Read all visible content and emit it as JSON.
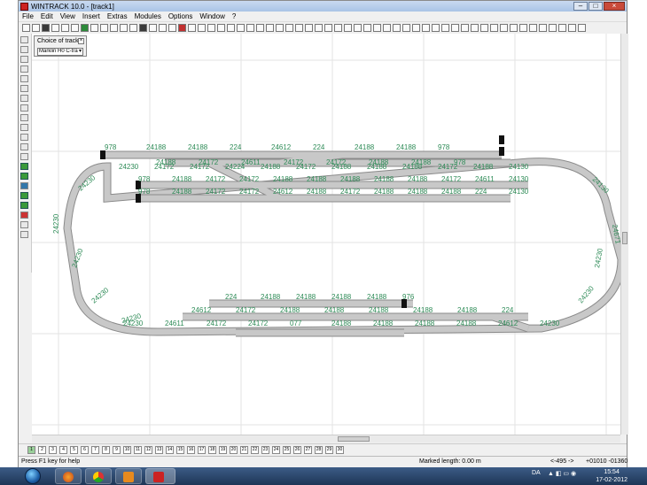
{
  "window": {
    "title": "WINTRACK 10.0 - [track1]"
  },
  "menu": [
    "File",
    "Edit",
    "View",
    "Insert",
    "Extras",
    "Modules",
    "Options",
    "Window",
    "?"
  ],
  "choice_panel": {
    "title": "Choice of track",
    "close": "×",
    "selected": "Märklin H0 C-tra"
  },
  "statusbar": {
    "help": "Press F1 key for help",
    "marked_length": "Marked length: 0.00 m",
    "cursor_x": "<-495 ->",
    "coords": "+01010 -01360"
  },
  "pages": [
    "1",
    "2",
    "3",
    "4",
    "5",
    "6",
    "7",
    "8",
    "9",
    "10",
    "11",
    "12",
    "13",
    "14",
    "15",
    "16",
    "17",
    "18",
    "19",
    "20",
    "21",
    "22",
    "23",
    "24",
    "25",
    "26",
    "27",
    "28",
    "29",
    "30"
  ],
  "taskbar": {
    "lang": "DA",
    "time": "15:54",
    "date": "17-02-2012"
  },
  "colors": {
    "label_green": "#2e8b57",
    "track_grey": "#b5b5b5",
    "grid": "#e3e3e3",
    "title_blue": "#b9cfec"
  },
  "layout_labels": {
    "top_row1": [
      "978",
      "24188",
      "24188",
      "224",
      "24612",
      "224",
      "24188",
      "24188",
      "978"
    ],
    "top_row2": [
      "24188",
      "24172",
      "24611",
      "24172",
      "24172",
      "24188",
      "24188",
      "978"
    ],
    "top_row3": [
      "24230",
      "24172",
      "24172",
      "24224",
      "24188",
      "24172",
      "24188",
      "24188",
      "24188",
      "24172",
      "24188",
      "24130"
    ],
    "top_row4": [
      "978",
      "24188",
      "24172",
      "24172",
      "24188",
      "24188",
      "24188",
      "24188",
      "24188",
      "24172",
      "24611",
      "24130"
    ],
    "top_row5": [
      "978",
      "24188",
      "24172",
      "24172",
      "24612",
      "24188",
      "24172",
      "24188",
      "24188",
      "24188",
      "224",
      "24130"
    ],
    "left_curve": [
      "24230",
      "24230",
      "24230",
      "24230",
      "24230"
    ],
    "right_curve": [
      "24130",
      "24671",
      "24230",
      "24230"
    ],
    "bot_row1": [
      "224",
      "24188",
      "24188",
      "24188",
      "24188",
      "976"
    ],
    "bot_row2": [
      "24612",
      "24172",
      "24188",
      "24188",
      "24188",
      "24188",
      "24188",
      "224"
    ],
    "bot_row3": [
      "24230",
      "24611",
      "24172",
      "24172",
      "077",
      "24188",
      "24188",
      "24188",
      "24188",
      "24612",
      "24230"
    ]
  }
}
